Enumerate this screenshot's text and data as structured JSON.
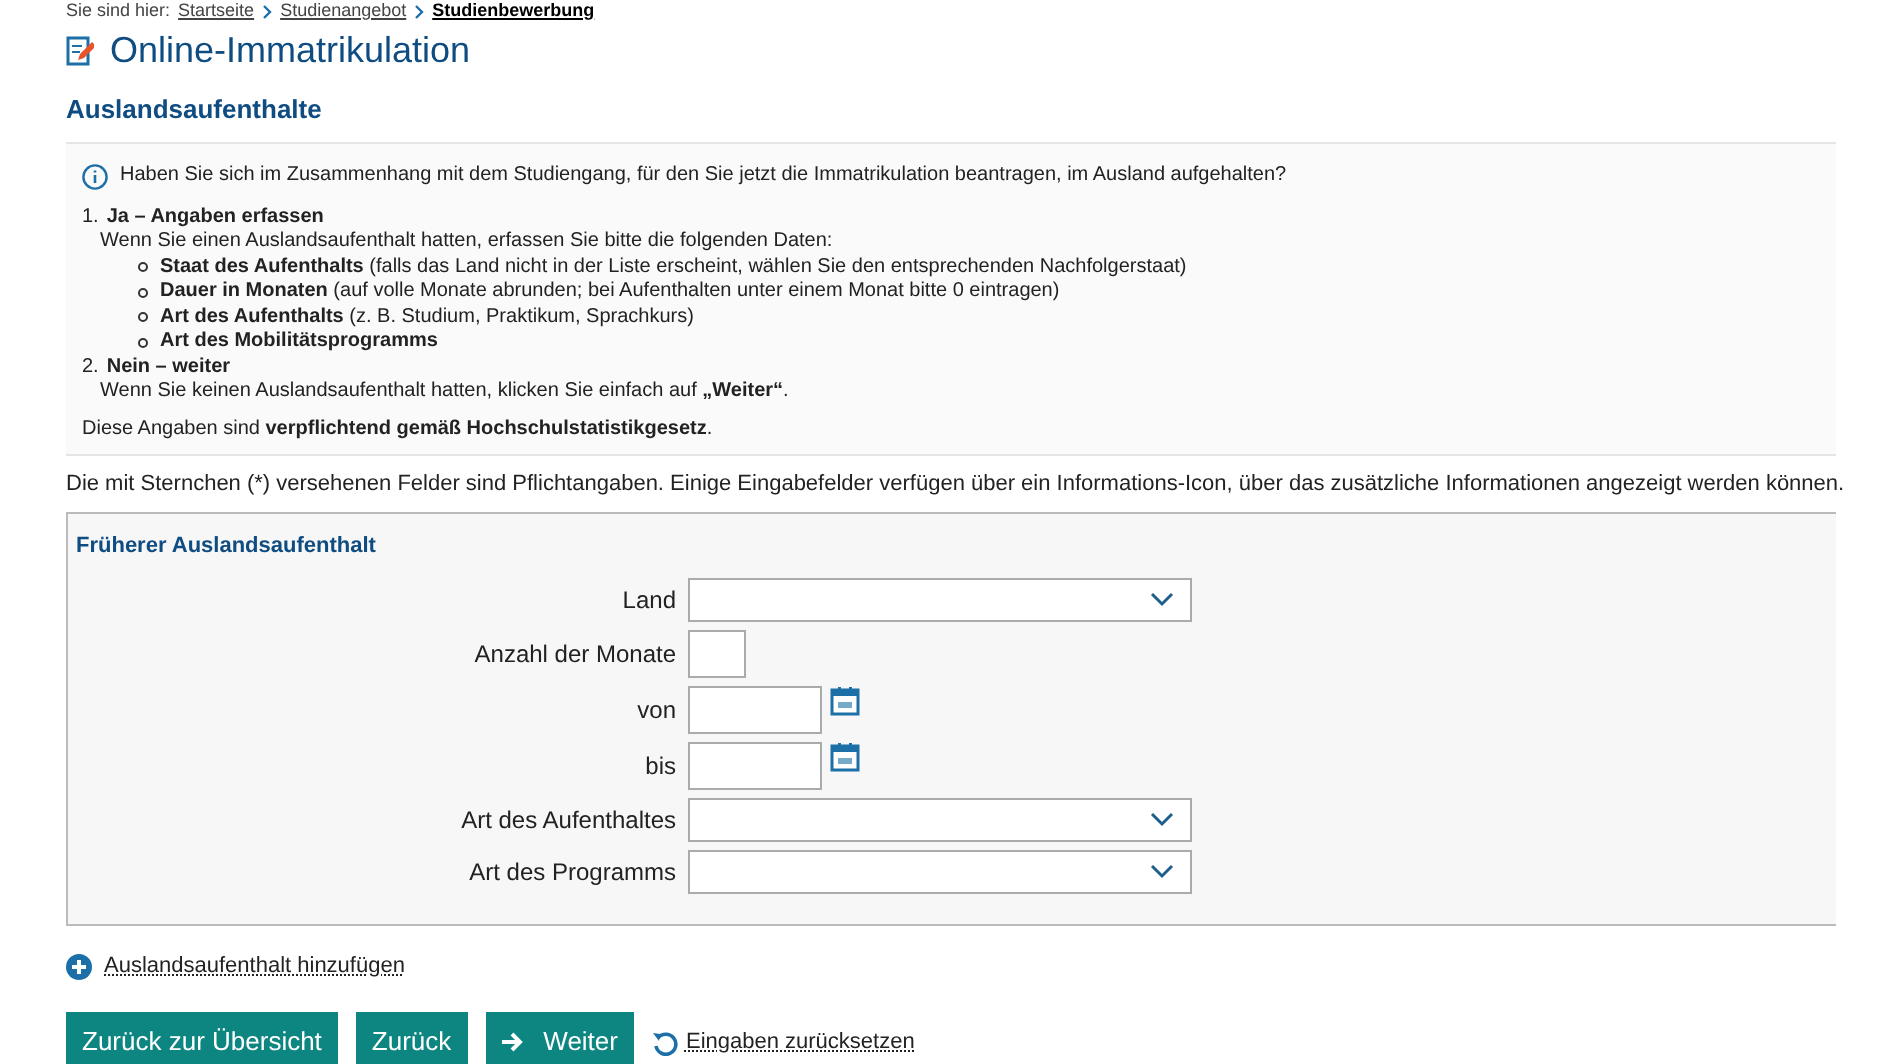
{
  "breadcrumb": {
    "label": "Sie sind hier:",
    "items": [
      {
        "text": "Startseite",
        "kind": "link"
      },
      {
        "text": "Studienangebot",
        "kind": "link"
      },
      {
        "text": "Studienbewerbung",
        "kind": "current"
      }
    ]
  },
  "title": "Online-Immatrikulation",
  "subtitle": "Auslandsaufenthalte",
  "info": {
    "question": "Haben Sie sich im Zusammenhang mit dem Studiengang, für den Sie jetzt die Immatrikulation beantragen, im Ausland aufgehalten?",
    "steps": [
      {
        "number": "1.",
        "heading": "Ja – Angaben erfassen",
        "text": "Wenn Sie einen Auslandsaufenthalt hatten, erfassen Sie bitte die folgenden Daten:",
        "bullets": [
          "**Staat des Aufenthalts** (falls das Land nicht in der Liste erscheint, wählen Sie den entsprechenden Nachfolgerstaat)",
          "**Dauer in Monaten** (auf volle Monate abrunden; bei Aufenthalten unter einem Monat bitte 0 eintragen)",
          "**Art des Aufenthalts** (z. B. Studium, Praktikum, Sprachkurs)",
          "**Art des Mobilitätsprogramms**"
        ]
      },
      {
        "number": "2.",
        "heading": "Nein – weiter",
        "text": "Wenn Sie keinen Auslandsaufenthalt hatten, klicken Sie einfach auf **„Weiter“**."
      }
    ],
    "note": "Diese Angaben sind **verpflichtend gemäß Hochschulstatistikgesetz**."
  },
  "required_note": "Die mit Sternchen (*) versehenen Felder sind Pflichtangaben. Einige Eingabefelder verfügen über ein Informations-Icon, über das zusätzliche Informationen angezeigt werden können.",
  "form": {
    "title": "Früherer Auslandsaufenthalt",
    "fields": [
      {
        "label": "Land",
        "kind": "select"
      },
      {
        "label": "Anzahl der Monate",
        "kind": "number"
      },
      {
        "label": "von",
        "kind": "date"
      },
      {
        "label": "bis",
        "kind": "date"
      },
      {
        "label": "Art des Aufenthaltes",
        "kind": "select"
      },
      {
        "label": "Art des Programms",
        "kind": "select"
      }
    ]
  },
  "add_link": "Auslandsaufenthalt hinzufügen",
  "buttons": [
    {
      "label": "Zurück zur Übersicht",
      "kind": "plain"
    },
    {
      "label": "Zurück",
      "kind": "plain"
    },
    {
      "label": "Weiter",
      "kind": "next"
    }
  ],
  "reset_link": "Eingaben zurücksetzen"
}
